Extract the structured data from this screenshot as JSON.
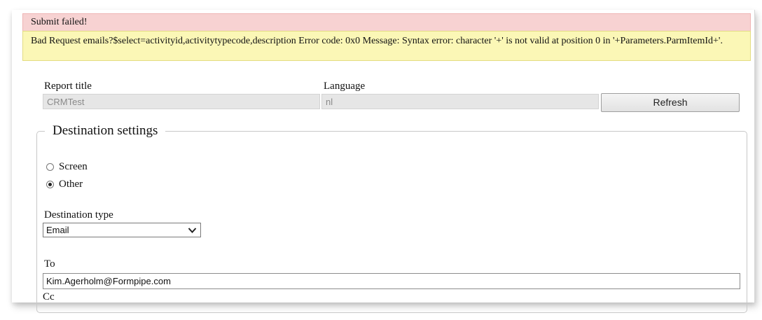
{
  "banners": {
    "error_title": "Submit failed!",
    "error_detail": "Bad Request emails?$select=activityid,activitytypecode,description Error code: 0x0 Message: Syntax error: character '+' is not valid at position 0 in '+Parameters.ParmItemId+'."
  },
  "report": {
    "title_label": "Report title",
    "title_value": "CRMTest",
    "language_label": "Language",
    "language_value": "nl",
    "refresh_label": "Refresh"
  },
  "destination": {
    "legend": "Destination settings",
    "options": [
      {
        "label": "Screen",
        "selected": false
      },
      {
        "label": "Other",
        "selected": true
      }
    ],
    "type_label": "Destination type",
    "type_value": "Email",
    "to_label": "To",
    "to_value": "Kim.Agerholm@Formpipe.com",
    "cc_label": "Cc"
  },
  "icons": {
    "select_arrow": "chevron-down-icon"
  }
}
